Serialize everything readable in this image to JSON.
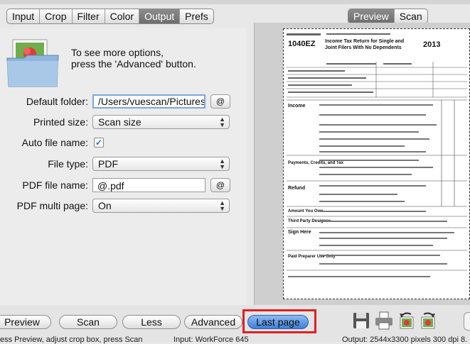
{
  "tabs": {
    "left": [
      "Input",
      "Crop",
      "Filter",
      "Color",
      "Output",
      "Prefs"
    ],
    "active_left": "Output",
    "right": [
      "Preview",
      "Scan"
    ],
    "active_right": "Preview"
  },
  "hint": {
    "line1": "To see more options,",
    "line2": "press the 'Advanced' button."
  },
  "settings": {
    "default_folder": {
      "label": "Default folder:",
      "value": "/Users/vuescan/Pictures",
      "button": "@"
    },
    "printed_size": {
      "label": "Printed size:",
      "value": "Scan size"
    },
    "auto_file_name": {
      "label": "Auto file name:",
      "checked_glyph": "✓"
    },
    "file_type": {
      "label": "File type:",
      "value": "PDF"
    },
    "pdf_file_name": {
      "label": "PDF file name:",
      "value": "@.pdf",
      "button": "@"
    },
    "pdf_multi_page": {
      "label": "PDF multi page:",
      "value": "On"
    }
  },
  "document": {
    "form": "1040EZ",
    "title_line1": "Income Tax Return for Single and",
    "title_line2": "Joint Filers With No Dependents",
    "year": "2013",
    "sections": [
      "Income",
      "Payments, Credits, and Tax",
      "Refund",
      "Amount You Owe",
      "Third Party Designee",
      "Sign Here",
      "Paid Preparer Use Only"
    ]
  },
  "bottom_buttons": {
    "preview": "Preview",
    "scan": "Scan",
    "less": "Less",
    "advanced": "Advanced",
    "last_page": "Last page"
  },
  "status": {
    "left": "ess Preview, adjust crop box, press Scan",
    "middle": "Input: WorkForce 645",
    "right": "Output: 2544x3300 pixels 300 dpi 8."
  },
  "icons": [
    "folder-photo-icon",
    "save-icon",
    "print-icon",
    "rotate-left-icon",
    "rotate-right-icon"
  ]
}
